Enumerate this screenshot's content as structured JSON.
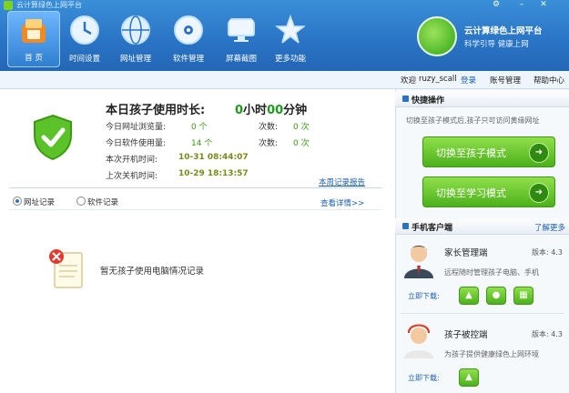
{
  "window": {
    "title": "云计算绿色上网平台"
  },
  "toolbar": {
    "items": [
      {
        "label": "首  页",
        "icon": "home-icon"
      },
      {
        "label": "时间设置",
        "icon": "clock-icon"
      },
      {
        "label": "网址管理",
        "icon": "globe-icon"
      },
      {
        "label": "软件管理",
        "icon": "disc-icon"
      },
      {
        "label": "屏幕截图",
        "icon": "monitor-icon"
      },
      {
        "label": "更多功能",
        "icon": "star-icon"
      }
    ]
  },
  "brand": {
    "title": "云计算绿色上网平台",
    "subtitle": "科学引导 健康上网"
  },
  "userbar": {
    "welcome": "欢迎",
    "username": "ruzy_scall",
    "logout": "登录",
    "account": "账号管理",
    "help": "帮助中心"
  },
  "usage": {
    "title": "本日孩子使用时长:",
    "hours": "0",
    "hours_unit": "小时",
    "minutes": "00",
    "minutes_unit": "分钟",
    "url_views_label": "今日网址浏览量:",
    "url_views": "0 个",
    "url_times_label": "次数:",
    "url_times": "0 次",
    "software_label": "今日软件使用量:",
    "software": "14 个",
    "software_times_label": "次数:",
    "software_times": "0 次",
    "boot_label": "本次开机时间:",
    "boot_time": "10-31 08:44:07",
    "shutdown_label": "上次关机时间:",
    "shutdown_time": "10-29 18:13:57",
    "weekly_report": "本周记录报告"
  },
  "records": {
    "tab_url": "网址记录",
    "tab_software": "软件记录",
    "more": "查看详情>>",
    "empty": "暂无孩子使用电脑情况记录"
  },
  "shortcuts": {
    "title": "快捷操作",
    "hint": "切换至孩子模式后,孩子只可访问黄缘网址",
    "child_mode": "切换至孩子模式",
    "study_mode": "切换至学习模式"
  },
  "mobile": {
    "title": "手机客户端",
    "more": "了解更多",
    "parent": {
      "name": "家长管理端",
      "version": "版本: 4.3",
      "desc": "远程随时管理孩子电脑、手机",
      "download": "立即下载:"
    },
    "child": {
      "name": "孩子被控端",
      "version": "版本: 4.3",
      "desc": "为孩子提供健康绿色上网环境",
      "download": "立即下载:"
    }
  },
  "colors": {
    "toolbar": "#2a73c4",
    "accent_green": "#4cb01c",
    "time_green": "#1e9a1e",
    "link": "#1a5fb0"
  }
}
